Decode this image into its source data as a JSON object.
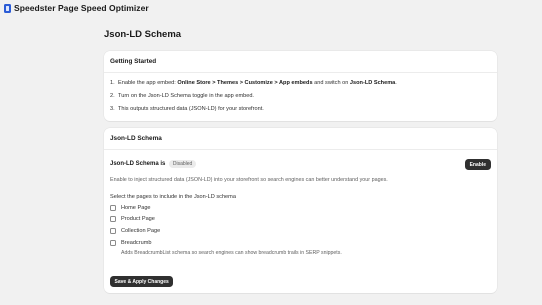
{
  "app": {
    "title": "Speedster Page Speed Optimizer",
    "logo_icon": "app-logo-icon"
  },
  "page": {
    "title": "Json-LD Schema"
  },
  "getting_started": {
    "heading": "Getting Started",
    "steps": [
      {
        "num": "1.",
        "pre": "Enable the app embed: ",
        "bold1": "Online Store > Themes > Customize > App embeds",
        "mid": " and switch on ",
        "bold2": "Json-LD Schema",
        "post": "."
      },
      {
        "num": "2.",
        "text": "Turn on the Json-LD Schema toggle in the app embed."
      },
      {
        "num": "3.",
        "text": "This outputs structured data (JSON-LD) for your storefront."
      }
    ]
  },
  "schema": {
    "heading": "Json-LD Schema",
    "status_label": "Json-LD Schema is",
    "status_badge": "Disabled",
    "enable_label": "Enable",
    "description": "Enable to inject structured data (JSON-LD) into your storefront so search engines can better understand your pages.",
    "select_label": "Select the pages to include in the Json-LD schema",
    "options": [
      {
        "label": "Home Page",
        "checked": false
      },
      {
        "label": "Product Page",
        "checked": false
      },
      {
        "label": "Collection Page",
        "checked": false
      },
      {
        "label": "Breadcrumb",
        "checked": false
      }
    ],
    "breadcrumb_help": "Adds BreadcrumbList schema so search engines can show breadcrumb trails in SERP snippets.",
    "save_label": "Save & Apply Changes"
  }
}
